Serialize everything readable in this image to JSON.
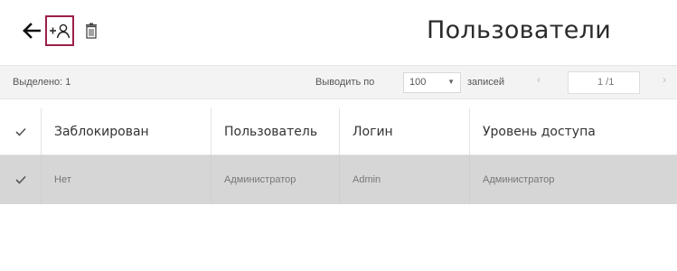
{
  "toolbar": {
    "back_icon": "arrow-left-icon",
    "add_user_icon": "add-user-icon",
    "delete_icon": "trash-icon",
    "accent_color": "#9c1f4a"
  },
  "header": {
    "title": "Пользователи"
  },
  "info_bar": {
    "selected": "Выделено: 1",
    "per_page_label": "Выводить по",
    "per_page_value": "100",
    "records_label": "записей",
    "page_value": "1 /1"
  },
  "table": {
    "columns": [
      "Заблокирован",
      "Пользователь",
      "Логин",
      "Уровень доступа"
    ],
    "rows": [
      {
        "selected": true,
        "blocked": "Нет",
        "user": "Администратор",
        "login": "Admin",
        "access": "Администратор"
      }
    ]
  }
}
